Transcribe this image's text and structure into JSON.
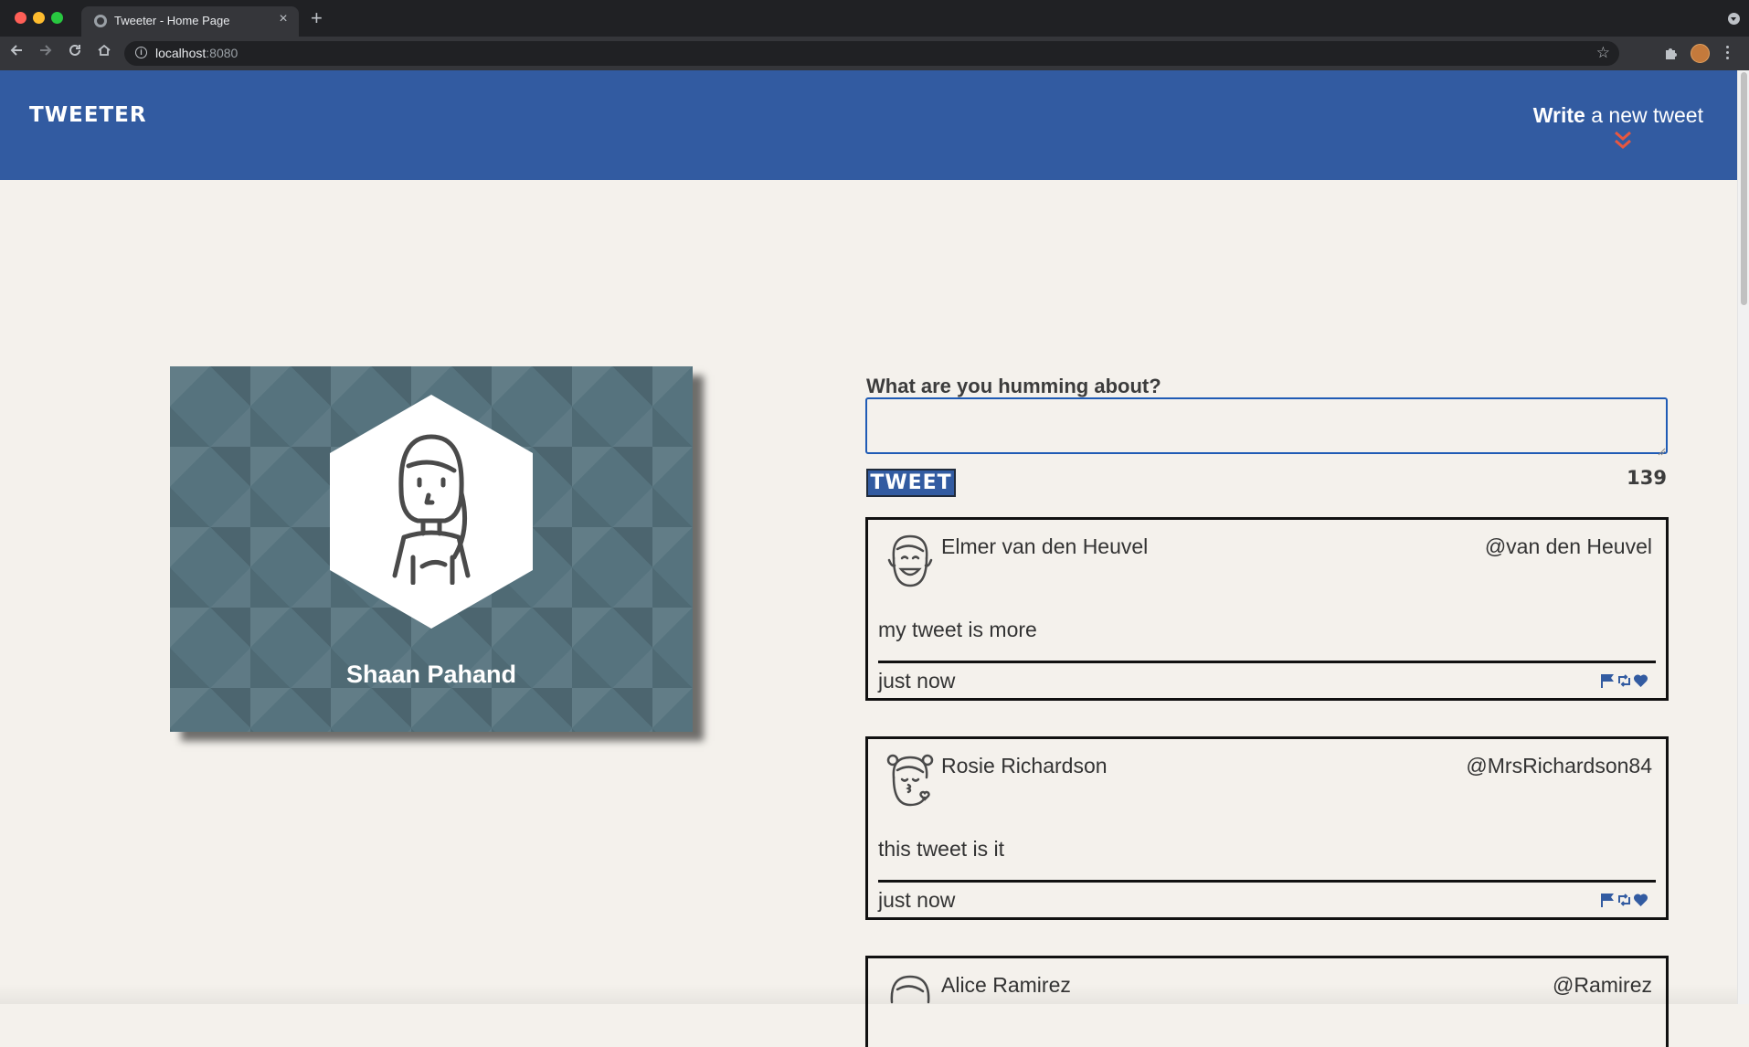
{
  "browser": {
    "tab_title": "Tweeter - Home Page",
    "new_tab_symbol": "+",
    "close_symbol": "×",
    "url_host": "localhost",
    "url_port": ":8080",
    "star_symbol": "☆"
  },
  "header": {
    "brand": "TWEETER",
    "compose_bold": "Write",
    "compose_rest": " a new tweet",
    "accent_color": "#e8573f",
    "nav_color": "#325ba1"
  },
  "profile": {
    "name": "Shaan Pahand",
    "avatar_icon": "female-avatar-icon"
  },
  "compose": {
    "label": "What are you humming about?",
    "value": "",
    "placeholder": "",
    "button_label": "TWEET",
    "counter": "139"
  },
  "tweets": [
    {
      "name": "Elmer van den Heuvel",
      "handle": "@van den Heuvel",
      "body": "my tweet is more",
      "time": "just now",
      "avatar_icon": "smiling-boy-avatar-icon"
    },
    {
      "name": "Rosie Richardson",
      "handle": "@MrsRichardson84",
      "body": "this tweet is it",
      "time": "just now",
      "avatar_icon": "kissing-girl-avatar-icon"
    },
    {
      "name": "Alice Ramirez",
      "handle": "@Ramirez",
      "avatar_icon": "woman-avatar-icon"
    }
  ],
  "actions": [
    "flag-icon",
    "retweet-icon",
    "heart-icon"
  ]
}
